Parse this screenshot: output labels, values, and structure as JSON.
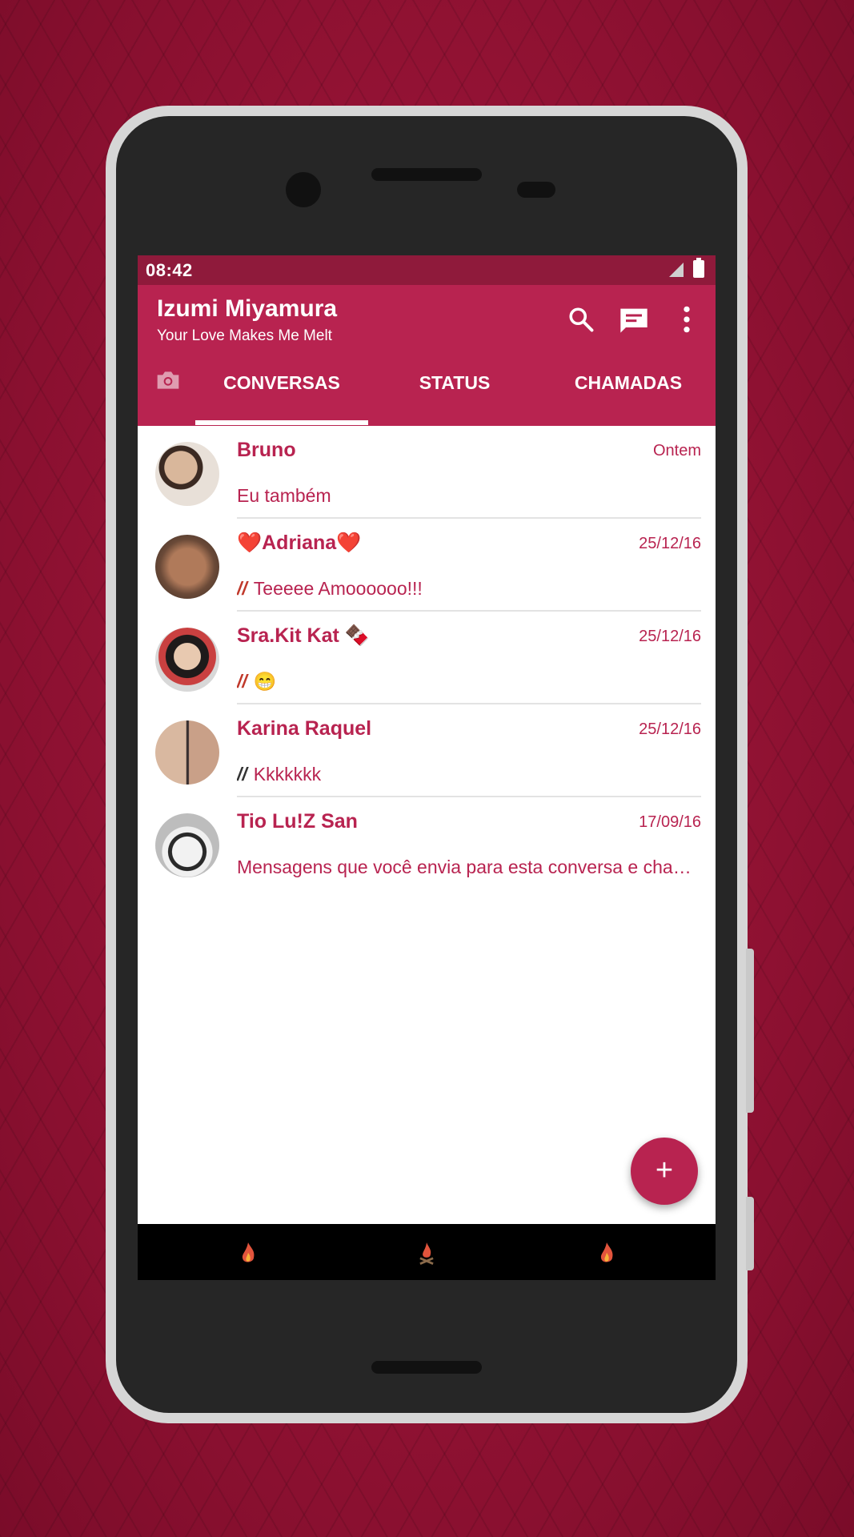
{
  "status_bar": {
    "time": "08:42"
  },
  "app_bar": {
    "title": "Izumi Miyamura",
    "subtitle": "Your Love Makes Me Melt",
    "actions": [
      "search-icon",
      "compose-icon",
      "more-vert-icon"
    ]
  },
  "tabs": [
    {
      "label": "CONVERSAS",
      "selected": true
    },
    {
      "label": "STATUS",
      "selected": false
    },
    {
      "label": "CHAMADAS",
      "selected": false
    }
  ],
  "chats": [
    {
      "name": "Bruno",
      "date": "Ontem",
      "tick": "",
      "message": "Eu também"
    },
    {
      "name": "❤️Adriana❤️",
      "date": "25/12/16",
      "tick": "//",
      "message": "Teeeee Amoooooo!!!"
    },
    {
      "name": "Sra.Kit Kat 🍫",
      "date": "25/12/16",
      "tick": "//",
      "message": "😁"
    },
    {
      "name": "Karina Raquel",
      "date": "25/12/16",
      "tick": "//",
      "message": "Kkkkkkk"
    },
    {
      "name": "Tio Lu!Z San",
      "date": "17/09/16",
      "tick": "",
      "message": "Mensagens que você envia para esta conversa e chamadas agora são protegidas"
    }
  ],
  "fab": {
    "label": "+"
  },
  "colors": {
    "primary": "#b82350",
    "status_bar": "#8f1a3b",
    "background": "#8e1231"
  }
}
